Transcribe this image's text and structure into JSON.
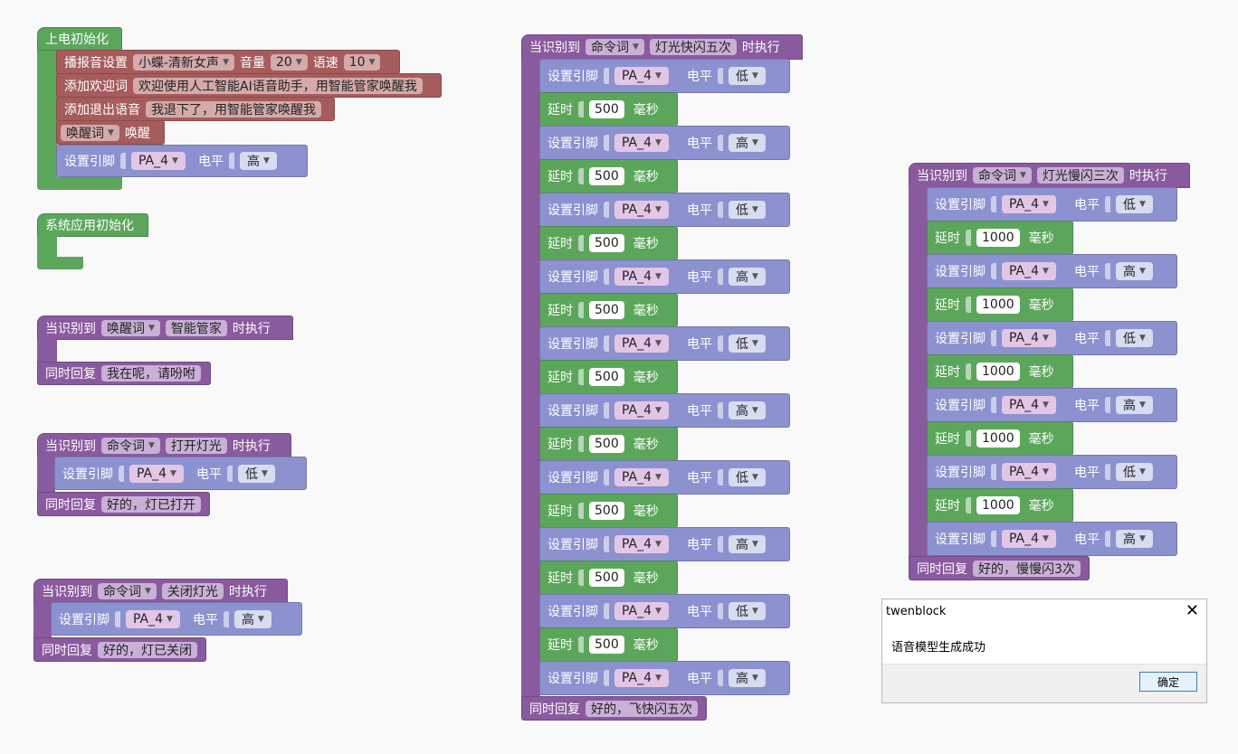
{
  "colors": {
    "green": "#5ca65c",
    "purple": "#8a5a9f",
    "blue": "#8c92d0",
    "brown": "#a65c5c"
  },
  "dropdown_icon": "triangle-down-icon",
  "init": {
    "hat": "上电初始化",
    "play": {
      "label": "播报音设置",
      "voice": "小蝶-清新女声",
      "vol_label": "音量",
      "vol": "20",
      "speed_label": "语速",
      "speed": "10"
    },
    "welcome": {
      "label": "添加欢迎词",
      "text": "欢迎使用人工智能AI语音助手，用智能管家唤醒我"
    },
    "exit": {
      "label": "添加退出语音",
      "text": "我退下了，用智能管家唤醒我"
    },
    "wake": {
      "dropdown": "唤醒词",
      "label": "唤醒"
    },
    "pin": {
      "label": "设置引脚",
      "pin": "PA_4",
      "level_label": "电平",
      "level": "高"
    }
  },
  "sys_init": {
    "hat": "系统应用初始化"
  },
  "on_wake": {
    "prefix": "当识别到",
    "type": "唤醒词",
    "word": "智能管家",
    "suffix": "时执行",
    "reply_label": "同时回复",
    "reply": "我在呢，请吩咐"
  },
  "on_open": {
    "prefix": "当识别到",
    "type": "命令词",
    "word": "打开灯光",
    "suffix": "时执行",
    "pin": {
      "label": "设置引脚",
      "pin": "PA_4",
      "level_label": "电平",
      "level": "低"
    },
    "reply_label": "同时回复",
    "reply": "好的，灯已打开"
  },
  "on_close": {
    "prefix": "当识别到",
    "type": "命令词",
    "word": "关闭灯光",
    "suffix": "时执行",
    "pin": {
      "label": "设置引脚",
      "pin": "PA_4",
      "level_label": "电平",
      "level": "高"
    },
    "reply_label": "同时回复",
    "reply": "好的，灯已关闭"
  },
  "on_fast": {
    "prefix": "当识别到",
    "type": "命令词",
    "word": "灯光快闪五次",
    "suffix": "时执行",
    "reply_label": "同时回复",
    "reply": "好的，飞快闪五次",
    "steps": [
      {
        "kind": "pin",
        "label": "设置引脚",
        "pin": "PA_4",
        "level_label": "电平",
        "level": "低"
      },
      {
        "kind": "delay",
        "label": "延时",
        "value": "500",
        "unit": "毫秒"
      },
      {
        "kind": "pin",
        "label": "设置引脚",
        "pin": "PA_4",
        "level_label": "电平",
        "level": "高"
      },
      {
        "kind": "delay",
        "label": "延时",
        "value": "500",
        "unit": "毫秒"
      },
      {
        "kind": "pin",
        "label": "设置引脚",
        "pin": "PA_4",
        "level_label": "电平",
        "level": "低"
      },
      {
        "kind": "delay",
        "label": "延时",
        "value": "500",
        "unit": "毫秒"
      },
      {
        "kind": "pin",
        "label": "设置引脚",
        "pin": "PA_4",
        "level_label": "电平",
        "level": "高"
      },
      {
        "kind": "delay",
        "label": "延时",
        "value": "500",
        "unit": "毫秒"
      },
      {
        "kind": "pin",
        "label": "设置引脚",
        "pin": "PA_4",
        "level_label": "电平",
        "level": "低"
      },
      {
        "kind": "delay",
        "label": "延时",
        "value": "500",
        "unit": "毫秒"
      },
      {
        "kind": "pin",
        "label": "设置引脚",
        "pin": "PA_4",
        "level_label": "电平",
        "level": "高"
      },
      {
        "kind": "delay",
        "label": "延时",
        "value": "500",
        "unit": "毫秒"
      },
      {
        "kind": "pin",
        "label": "设置引脚",
        "pin": "PA_4",
        "level_label": "电平",
        "level": "低"
      },
      {
        "kind": "delay",
        "label": "延时",
        "value": "500",
        "unit": "毫秒"
      },
      {
        "kind": "pin",
        "label": "设置引脚",
        "pin": "PA_4",
        "level_label": "电平",
        "level": "高"
      },
      {
        "kind": "delay",
        "label": "延时",
        "value": "500",
        "unit": "毫秒"
      },
      {
        "kind": "pin",
        "label": "设置引脚",
        "pin": "PA_4",
        "level_label": "电平",
        "level": "低"
      },
      {
        "kind": "delay",
        "label": "延时",
        "value": "500",
        "unit": "毫秒"
      },
      {
        "kind": "pin",
        "label": "设置引脚",
        "pin": "PA_4",
        "level_label": "电平",
        "level": "高"
      }
    ]
  },
  "on_slow": {
    "prefix": "当识别到",
    "type": "命令词",
    "word": "灯光慢闪三次",
    "suffix": "时执行",
    "reply_label": "同时回复",
    "reply": "好的，慢慢闪3次",
    "steps": [
      {
        "kind": "pin",
        "label": "设置引脚",
        "pin": "PA_4",
        "level_label": "电平",
        "level": "低"
      },
      {
        "kind": "delay",
        "label": "延时",
        "value": "1000",
        "unit": "毫秒"
      },
      {
        "kind": "pin",
        "label": "设置引脚",
        "pin": "PA_4",
        "level_label": "电平",
        "level": "高"
      },
      {
        "kind": "delay",
        "label": "延时",
        "value": "1000",
        "unit": "毫秒"
      },
      {
        "kind": "pin",
        "label": "设置引脚",
        "pin": "PA_4",
        "level_label": "电平",
        "level": "低"
      },
      {
        "kind": "delay",
        "label": "延时",
        "value": "1000",
        "unit": "毫秒"
      },
      {
        "kind": "pin",
        "label": "设置引脚",
        "pin": "PA_4",
        "level_label": "电平",
        "level": "高"
      },
      {
        "kind": "delay",
        "label": "延时",
        "value": "1000",
        "unit": "毫秒"
      },
      {
        "kind": "pin",
        "label": "设置引脚",
        "pin": "PA_4",
        "level_label": "电平",
        "level": "低"
      },
      {
        "kind": "delay",
        "label": "延时",
        "value": "1000",
        "unit": "毫秒"
      },
      {
        "kind": "pin",
        "label": "设置引脚",
        "pin": "PA_4",
        "level_label": "电平",
        "level": "高"
      }
    ]
  },
  "dialog": {
    "title": "twenblock",
    "message": "语音模型生成成功",
    "ok": "确定"
  }
}
